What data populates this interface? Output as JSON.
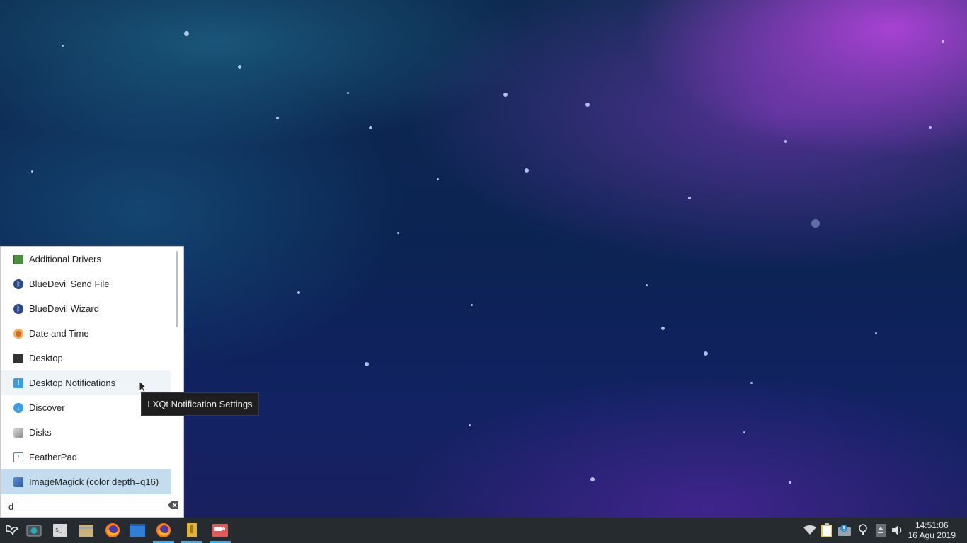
{
  "menu": {
    "items": [
      {
        "label": "Additional Drivers",
        "icon": "additional-drivers-icon",
        "color": "#4b8f3a"
      },
      {
        "label": "BlueDevil Send File",
        "icon": "bluetooth-icon",
        "color": "#2c4a8c"
      },
      {
        "label": "BlueDevil Wizard",
        "icon": "bluetooth-icon",
        "color": "#2c4a8c"
      },
      {
        "label": "Date and Time",
        "icon": "clock-icon",
        "color": "#d26a1e"
      },
      {
        "label": "Desktop",
        "icon": "desktop-icon",
        "color": "#333333"
      },
      {
        "label": "Desktop Notifications",
        "icon": "notification-icon",
        "color": "#3a9ddf"
      },
      {
        "label": "Discover",
        "icon": "discover-icon",
        "color": "#3a9ddf"
      },
      {
        "label": "Disks",
        "icon": "disks-icon",
        "color": "#888888"
      },
      {
        "label": "FeatherPad",
        "icon": "featherpad-icon",
        "color": "#6a7a8a"
      },
      {
        "label": "ImageMagick (color depth=q16)",
        "icon": "imagemagick-icon",
        "color": "#3b6fb0"
      }
    ],
    "hovered_index": 5,
    "selected_index": 9
  },
  "search": {
    "value": "d",
    "clear_icon": "clear-text-icon"
  },
  "tooltip": {
    "text": "LXQt Notification Settings"
  },
  "taskbar": {
    "launchers": [
      {
        "name": "start-menu-icon"
      },
      {
        "name": "screenshot-icon"
      },
      {
        "name": "terminal-icon"
      },
      {
        "name": "file-manager-icon"
      },
      {
        "name": "firefox-icon"
      },
      {
        "name": "window-icon"
      },
      {
        "name": "firefox-window-icon"
      },
      {
        "name": "archive-icon"
      },
      {
        "name": "screenshot-app-icon"
      }
    ],
    "tray": [
      "wifi-icon",
      "clipboard-icon",
      "notification-tray-icon",
      "bulb-icon",
      "eject-icon",
      "volume-icon"
    ],
    "clock": {
      "time": "14:51:06",
      "date": "16 Agu 2019"
    }
  }
}
